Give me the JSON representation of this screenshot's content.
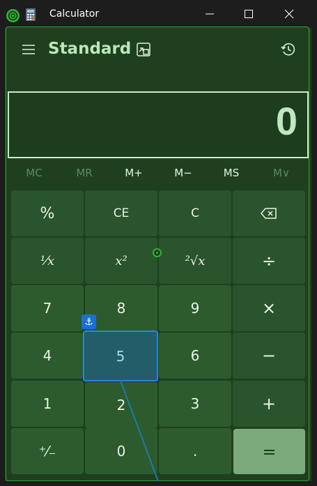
{
  "window": {
    "title": "Calculator",
    "controls": {
      "minimize": "minimize",
      "maximize": "maximize",
      "close": "close"
    }
  },
  "header": {
    "mode": "Standard",
    "icons": [
      "hamburger-menu-icon",
      "keep-on-top-icon",
      "history-icon"
    ]
  },
  "display": {
    "value": "0"
  },
  "memory": [
    "MC",
    "MR",
    "M+",
    "M−",
    "MS",
    "M∨"
  ],
  "keys": {
    "percent": "%",
    "ce": "CE",
    "c": "C",
    "reciprocal": "¹⁄x",
    "square": "x²",
    "sqrt": "²√x",
    "divide": "÷",
    "seven": "7",
    "eight": "8",
    "nine": "9",
    "multiply": "×",
    "four": "4",
    "five": "5",
    "six": "6",
    "minus": "−",
    "one": "1",
    "two": "2",
    "three": "3",
    "plus": "+",
    "negate": "⁺⁄₋",
    "zero": "0",
    "decimal": ".",
    "equals": "="
  },
  "overlay": {
    "anchor": "⚓"
  }
}
